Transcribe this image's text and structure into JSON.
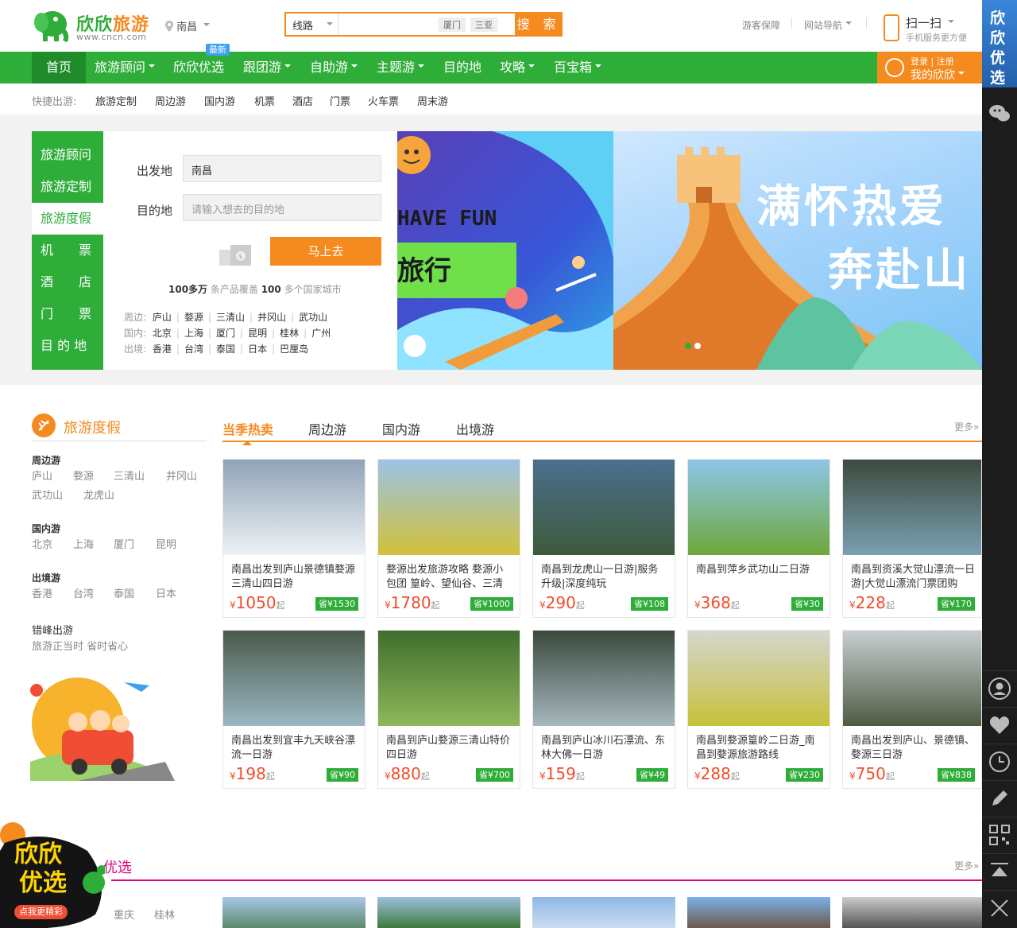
{
  "brand": {
    "name_a": "欣欣",
    "name_b": "旅游",
    "url": "www.cncn.com"
  },
  "location": "南昌",
  "search": {
    "type": "线路",
    "hot_tags": [
      "厦门",
      "三亚"
    ],
    "button": "搜 索",
    "placeholder": ""
  },
  "top_links": [
    "游客保障",
    "网站导航"
  ],
  "scan": {
    "title": "扫一扫",
    "sub": "手机服务更方便"
  },
  "nav": {
    "items": [
      "首页",
      "旅游顾问",
      "欣欣优选",
      "跟团游",
      "自助游",
      "主题游",
      "目的地",
      "攻略",
      "百宝箱"
    ],
    "new_badge": "最新"
  },
  "login": {
    "login": "登录",
    "register": "注册",
    "mine": "我的欣欣"
  },
  "quick": {
    "label": "快捷出游:",
    "items": [
      "旅游定制",
      "周边游",
      "国内游",
      "机票",
      "酒店",
      "门票",
      "火车票",
      "周末游"
    ]
  },
  "side_menu": [
    "旅游顾问",
    "旅游定制",
    "旅游度假",
    "机　　票",
    "酒　　店",
    "门　　票",
    "目 的 地"
  ],
  "form": {
    "from_label": "出发地",
    "from_value": "南昌",
    "to_label": "目的地",
    "to_placeholder": "请输入想去的目的地",
    "go": "马上去",
    "stat_a": "100多万",
    "stat_b": " 条产品覆盖 ",
    "stat_c": "100",
    "stat_d": " 多个国家城市"
  },
  "dest_rows": [
    {
      "label": "周边:",
      "items": [
        "庐山",
        "婺源",
        "三清山",
        "井冈山",
        "武功山"
      ]
    },
    {
      "label": "国内:",
      "items": [
        "北京",
        "上海",
        "厦门",
        "昆明",
        "桂林",
        "广州"
      ]
    },
    {
      "label": "出境:",
      "items": [
        "香港",
        "台湾",
        "泰国",
        "日本",
        "巴厘岛"
      ]
    }
  ],
  "banner": {
    "left_text_1": "HAVE FUN",
    "left_text_2": "旅行",
    "right_text_1": "满怀热爱",
    "right_text_2": "奔赴山"
  },
  "section": {
    "title": "旅游度假",
    "tabs": [
      "当季热卖",
      "周边游",
      "国内游",
      "出境游"
    ],
    "more": "更多»"
  },
  "side_groups": [
    {
      "title": "周边游",
      "links": [
        "庐山",
        "婺源",
        "三清山",
        "井冈山",
        "武功山",
        "龙虎山"
      ]
    },
    {
      "title": "国内游",
      "links": [
        "北京",
        "上海",
        "厦门",
        "昆明"
      ]
    },
    {
      "title": "出境游",
      "links": [
        "香港",
        "台湾",
        "泰国",
        "日本"
      ]
    },
    {
      "title": "错峰出游",
      "links": [
        "旅游正当时 省时省心"
      ]
    }
  ],
  "cards": [
    {
      "title": "南昌出发到庐山景德镇婺源三清山四日游",
      "price": "1050",
      "save": "省¥1530"
    },
    {
      "title": "婺源出发旅游攻略 婺源小包团 篁岭、望仙谷、三清",
      "price": "1780",
      "save": "省¥1000"
    },
    {
      "title": "南昌到龙虎山一日游|服务升级|深度纯玩",
      "price": "290",
      "save": "省¥108"
    },
    {
      "title": "南昌到萍乡武功山二日游",
      "price": "368",
      "save": "省¥30"
    },
    {
      "title": "南昌到资溪大觉山漂流一日游|大觉山漂流门票团购",
      "price": "228",
      "save": "省¥170"
    },
    {
      "title": "南昌出发到宜丰九天峡谷漂流一日游",
      "price": "198",
      "save": "省¥90"
    },
    {
      "title": "南昌到庐山婺源三清山特价四日游",
      "price": "880",
      "save": "省¥700"
    },
    {
      "title": "南昌到庐山冰川石漂流、东林大佛一日游",
      "price": "159",
      "save": "省¥49"
    },
    {
      "title": "南昌到婺源篁岭二日游_南昌到婺源旅游路线",
      "price": "288",
      "save": "省¥230"
    },
    {
      "title": "南昌出发到庐山、景德镇、婺源三日游",
      "price": "750",
      "save": "省¥838"
    }
  ],
  "price_prefix": "¥",
  "price_suffix": "起",
  "section2": {
    "title": "优选",
    "more": "更多»",
    "cities": [
      "重庆",
      "桂林"
    ]
  },
  "promo": {
    "line1": "欣欣",
    "line2": "优选",
    "btn": "点我更精彩"
  },
  "rbar": {
    "title": [
      "欣",
      "欣",
      "优",
      "选"
    ]
  }
}
